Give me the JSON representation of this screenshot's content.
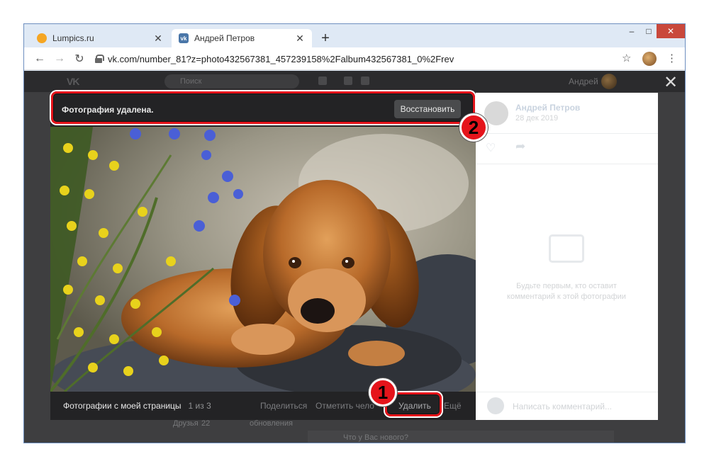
{
  "browser": {
    "tabs": [
      {
        "title": "Lumpics.ru",
        "favicon": "lumpics-favicon",
        "active": false
      },
      {
        "title": "Андрей Петров",
        "favicon": "vk-favicon",
        "active": true
      }
    ],
    "new_tab_label": "+",
    "url": "vk.com/number_81?z=photo432567381_457239158%2Falbum432567381_0%2Frev",
    "window_controls": {
      "minimize": "–",
      "maximize": "□",
      "close": "✕"
    },
    "nav": {
      "back": "←",
      "forward": "→",
      "reload": "↻",
      "star": "☆",
      "menu": "⋮"
    }
  },
  "vk_header": {
    "logo": "VK",
    "search_placeholder": "Поиск",
    "user_name": "Андрей"
  },
  "viewer": {
    "close_label": "✕",
    "notice": {
      "text": "Фотография удалена.",
      "restore_label": "Восстановить"
    },
    "bottom_bar": {
      "album_title": "Фотографии с моей страницы",
      "counter": "1 из 3",
      "actions": {
        "share": "Поделиться",
        "tag": "Отметить чело",
        "delete": "Удалить",
        "more": "Ещё"
      }
    },
    "sidebar": {
      "author_name": "Андрей Петров",
      "date": "28 дек 2019",
      "empty_comments": "Будьте первым, кто оставит комментарий к этой фотографии",
      "comment_placeholder": "Написать комментарий..."
    }
  },
  "background_page": {
    "friends_label": "Друзья",
    "friends_count": "22",
    "updates_label": "обновления",
    "post_prompt": "Что у Вас нового?"
  },
  "annotations": {
    "step1": "1",
    "step2": "2",
    "color": "#e5141b"
  }
}
